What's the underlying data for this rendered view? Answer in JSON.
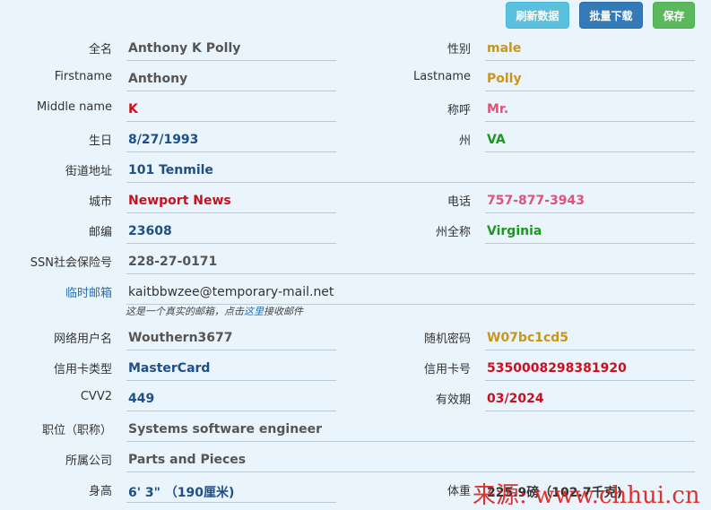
{
  "toolbar": {
    "refresh_label": "刷新数据",
    "batch_label": "批量下载",
    "save_label": "保存"
  },
  "fields": {
    "fullname": {
      "label": "全名",
      "value": "Anthony K Polly"
    },
    "gender": {
      "label": "性别",
      "value": "male"
    },
    "firstname": {
      "label": "Firstname",
      "value": "Anthony"
    },
    "lastname": {
      "label": "Lastname",
      "value": "Polly"
    },
    "middlename": {
      "label": "Middle name",
      "value": "K"
    },
    "title": {
      "label": "称呼",
      "value": "Mr."
    },
    "birthday": {
      "label": "生日",
      "value": "8/27/1993"
    },
    "state": {
      "label": "州",
      "value": "VA"
    },
    "street": {
      "label": "街道地址",
      "value": "101 Tenmile"
    },
    "city": {
      "label": "城市",
      "value": "Newport News"
    },
    "phone": {
      "label": "电话",
      "value": "757-877-3943"
    },
    "zipcode": {
      "label": "邮编",
      "value": "23608"
    },
    "state_full": {
      "label": "州全称",
      "value": "Virginia"
    },
    "ssn": {
      "label": "SSN社会保险号",
      "value": "228-27-0171"
    },
    "email": {
      "label": "临时邮箱",
      "value": "kaitbbwzee@temporary-mail.net",
      "note_prefix": "这是一个真实的邮箱，点击",
      "note_link": "这里",
      "note_suffix": "接收邮件"
    },
    "username": {
      "label": "网络用户名",
      "value": "Wouthern3677"
    },
    "password": {
      "label": "随机密码",
      "value": "W07bc1cd5"
    },
    "card_type": {
      "label": "信用卡类型",
      "value": "MasterCard"
    },
    "card_number": {
      "label": "信用卡号",
      "value": "5350008298381920"
    },
    "cvv": {
      "label": "CVV2",
      "value": "449"
    },
    "expiry": {
      "label": "有效期",
      "value": "03/2024"
    },
    "occupation": {
      "label": "职位（职称）",
      "value": "Systems software engineer"
    },
    "company": {
      "label": "所属公司",
      "value": "Parts and Pieces"
    },
    "height": {
      "label": "身高",
      "value": "6' 3\" （190厘米)"
    },
    "weight": {
      "label": "体重",
      "value": "225.9磅（102.7千克)"
    }
  },
  "watermark": "来源: www.chhui.cn",
  "colors": {
    "background": "#eaf4fc",
    "refresh_button": "#5bc0de",
    "batch_button": "#337ab7",
    "save_button": "#5cb85c"
  }
}
